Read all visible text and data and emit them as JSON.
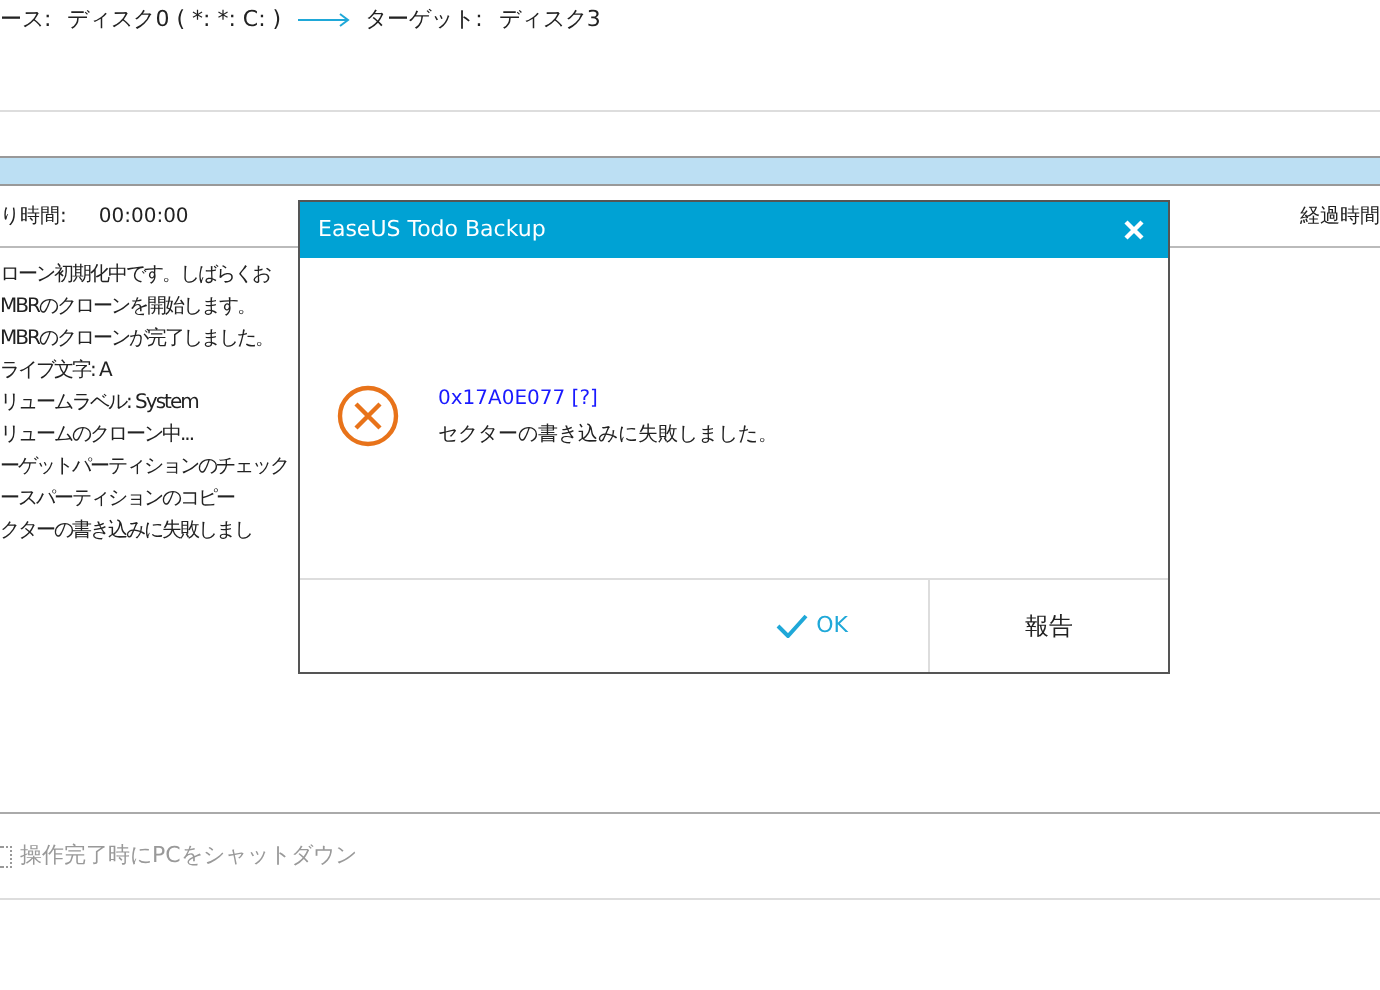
{
  "header": {
    "source_label": "ース:",
    "source_value": "ディスク0 ( *: *: C: )",
    "target_label": "ターゲット:",
    "target_value": "ディスク3"
  },
  "time_row": {
    "remaining_label": "り時間:",
    "remaining_value": "00:00:00",
    "elapsed_label": "経過時間"
  },
  "log": [
    "ローン初期化中です。しばらくお",
    "MBRのクローンを開始します。",
    "MBRのクローンが完了しました。",
    "ライブ文字: A",
    "リュームラベル: System",
    "リュームのクローン中...",
    "ーゲットパーティションのチェック",
    "ースパーティションのコピー",
    "クターの書き込みに失敗しまし"
  ],
  "shutdown_option": {
    "label": "操作完了時にPCをシャットダウン",
    "checked": false,
    "disabled": true
  },
  "dialog": {
    "title": "EaseUS Todo Backup",
    "error_code": "0x17A0E077 [?]",
    "message": "セクターの書き込みに失敗しました。",
    "buttons": [
      {
        "label": "OK",
        "kind": "ok"
      },
      {
        "label": "報告",
        "kind": "report"
      }
    ]
  }
}
